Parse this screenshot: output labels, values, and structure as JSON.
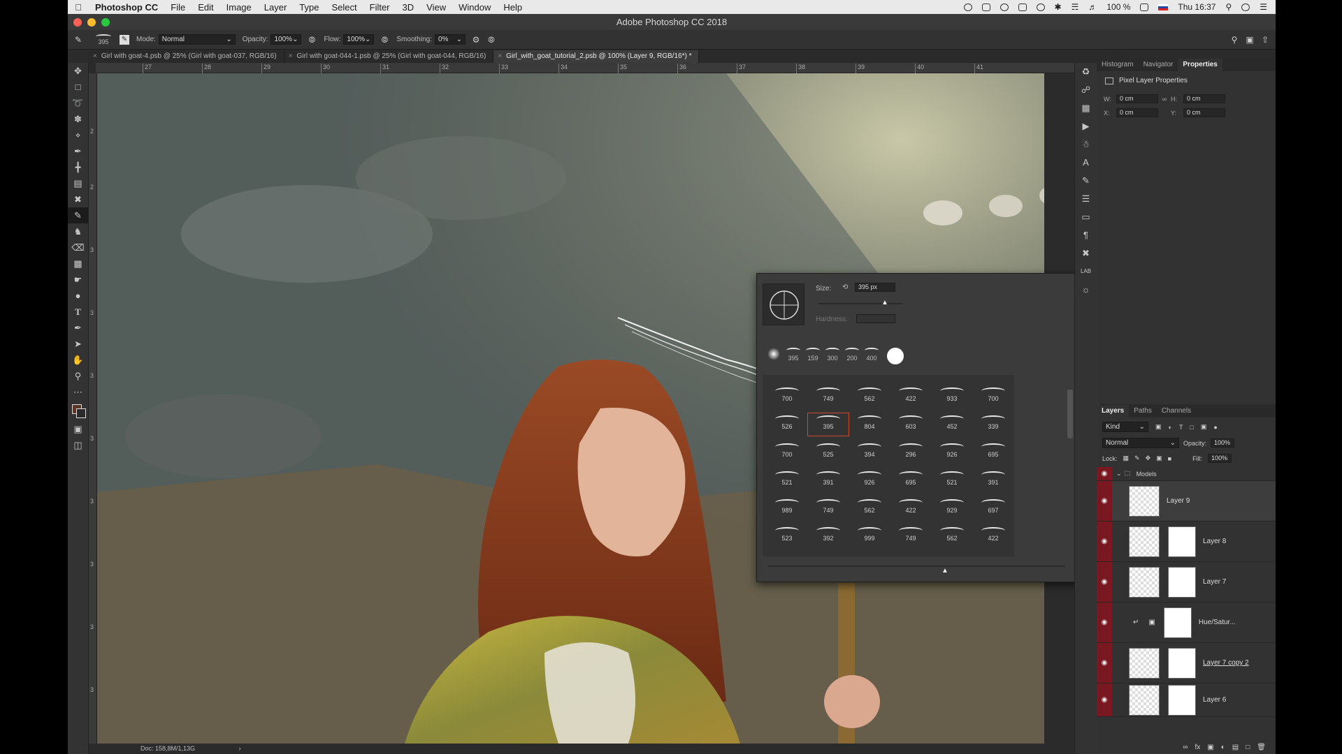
{
  "menubar": {
    "app": "Photoshop CC",
    "items": [
      "File",
      "Edit",
      "Image",
      "Layer",
      "Type",
      "Select",
      "Filter",
      "3D",
      "View",
      "Window",
      "Help"
    ],
    "battery": "100 %",
    "clock": "Thu 16:37"
  },
  "window": {
    "title": "Adobe Photoshop CC 2018"
  },
  "options": {
    "brush_size": "395",
    "mode_label": "Mode:",
    "mode_value": "Normal",
    "opacity_label": "Opacity:",
    "opacity_value": "100%",
    "flow_label": "Flow:",
    "flow_value": "100%",
    "smoothing_label": "Smoothing:",
    "smoothing_value": "0%"
  },
  "tabs": [
    {
      "label": "Girl with goat-4.psb @ 25% (Girl with goat-037, RGB/16)"
    },
    {
      "label": "Girl with goat-044-1.psb @ 25% (Girl with goat-044, RGB/16)"
    },
    {
      "label": "Girl_with_goat_tutorial_2.psb @ 100% (Layer 9, RGB/16*) *"
    }
  ],
  "ruler": {
    "top": [
      "27",
      "28",
      "29",
      "30",
      "31",
      "32",
      "33",
      "34",
      "35",
      "36",
      "37",
      "38",
      "39",
      "40",
      "41"
    ],
    "left": [
      "2",
      "2",
      "3",
      "3",
      "3",
      "3",
      "3",
      "3",
      "3",
      "3"
    ]
  },
  "status": {
    "doc": "Doc: 158,8M/1,13G"
  },
  "props": {
    "tabs": [
      "Histogram",
      "Navigator",
      "Properties"
    ],
    "title": "Pixel Layer Properties",
    "w_label": "W:",
    "w_value": "0 cm",
    "h_label": "H:",
    "h_value": "0 cm",
    "x_label": "X:",
    "x_value": "0 cm",
    "y_label": "Y:",
    "y_value": "0 cm"
  },
  "layers": {
    "tabs": [
      "Layers",
      "Paths",
      "Channels"
    ],
    "kind": "Kind",
    "blend": "Normal",
    "opacity_label": "Opacity:",
    "opacity_value": "100%",
    "lock_label": "Lock:",
    "fill_label": "Fill:",
    "fill_value": "100%",
    "group": "Models",
    "items": [
      {
        "name": "Layer 9"
      },
      {
        "name": "Layer 8"
      },
      {
        "name": "Layer 7"
      },
      {
        "name": "Hue/Satur..."
      },
      {
        "name": "Layer 7 copy 2"
      },
      {
        "name": "Layer 6"
      }
    ]
  },
  "picker": {
    "size_label": "Size:",
    "size_value": "395 px",
    "hardness_label": "Hardness:",
    "recent": [
      "395",
      "159",
      "300",
      "200",
      "400"
    ],
    "grid": [
      [
        "700",
        "749",
        "562",
        "422",
        "933",
        "700"
      ],
      [
        "526",
        "395",
        "804",
        "603",
        "452",
        "339"
      ],
      [
        "700",
        "525",
        "394",
        "296",
        "926",
        "695"
      ],
      [
        "521",
        "391",
        "926",
        "695",
        "521",
        "391"
      ],
      [
        "989",
        "749",
        "562",
        "422",
        "929",
        "697"
      ],
      [
        "523",
        "392",
        "999",
        "749",
        "562",
        "422"
      ]
    ]
  }
}
